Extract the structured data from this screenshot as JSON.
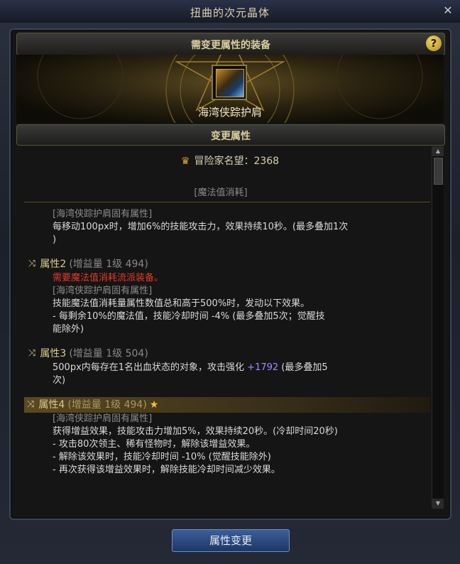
{
  "window": {
    "title": "扭曲的次元晶体",
    "close_icon": "close-icon"
  },
  "header": {
    "label": "需变更属性的装备",
    "help_label": "?"
  },
  "item": {
    "name": "海湾侠踪护肩",
    "icon": "shoulder-armor-icon"
  },
  "section": {
    "label": "变更属性"
  },
  "fame": {
    "icon": "fame-crest-icon",
    "label": "冒险家名望：2368"
  },
  "mp_header": "[魔法值消耗]",
  "properties": {
    "p1": {
      "fixed_tag": "[海湾侠踪护肩固有属性]",
      "line1": "每移动100px时，增加6%的技能攻击力，效果持续10秒。(最多叠加1次",
      "line2": ")"
    },
    "p2": {
      "name": "属性2",
      "level": "(增益量 1级 494)",
      "requirement": "需要魔法值消耗流派装备。",
      "fixed_tag": "[海湾侠踪护肩固有属性]",
      "line1": "技能魔法值消耗量属性数值总和高于500%时，发动以下效果。",
      "line2": "- 每剩余10%的魔法值，技能冷却时间 -4% (最多叠加5次；觉醒技",
      "line3": "能除外)"
    },
    "p3": {
      "name": "属性3",
      "level": "(增益量 1级 504)",
      "line1_a": "500px内每存在1名出血状态的对象，攻击强化 ",
      "line1_b": "+1792",
      "line1_c": " (最多叠加5",
      "line2": "次)"
    },
    "p4": {
      "name": "属性4",
      "level": "(增益量 1级 494)",
      "star": "★",
      "fixed_tag": "[海湾侠踪护肩固有属性]",
      "line1": "获得增益效果，技能攻击力增加5%，效果持续20秒。(冷却时间20秒)",
      "line2": "- 攻击80次领主、稀有怪物时，解除该增益效果。",
      "line3": "- 解除该效果时，技能冷却时间 -10% (觉醒技能除外)",
      "line4": "- 再次获得该增益效果时，解除技能冷却时间减少效果。"
    }
  },
  "button": {
    "label": "属性变更"
  },
  "colors": {
    "requirement_red": "#e13b2b",
    "attack_value_purple": "#a58bff",
    "gold_text": "#d9c98d",
    "button_blue": "#2a4c86"
  }
}
